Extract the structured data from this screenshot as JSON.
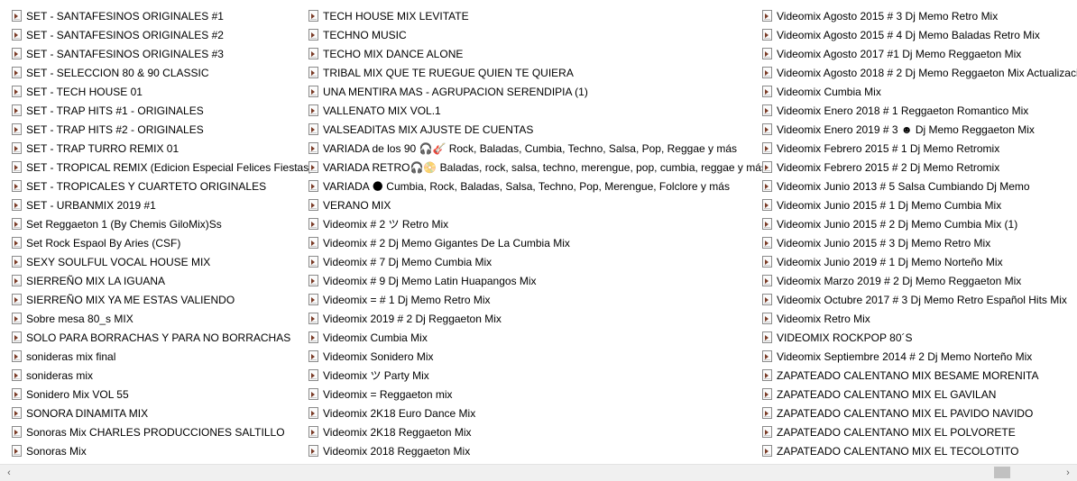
{
  "files": {
    "col1": [
      "SET - SANTAFESINOS ORIGINALES #1",
      "SET - SANTAFESINOS ORIGINALES #2",
      "SET - SANTAFESINOS ORIGINALES #3",
      "SET - SELECCION 80 & 90 CLASSIC",
      "SET - TECH HOUSE 01",
      "SET - TRAP HITS #1 - ORIGINALES",
      "SET - TRAP HITS #2 - ORIGINALES",
      "SET - TRAP TURRO REMIX 01",
      "SET - TROPICAL REMIX (Edicion Especial Felices Fiestas)",
      "SET - TROPICALES Y CUARTETO ORIGINALES",
      "SET - URBANMIX 2019  #1",
      "Set Reggaeton 1 (By Chemis GiloMix)Ss",
      "Set Rock Espaol By Aries (CSF)",
      "SEXY SOULFUL VOCAL HOUSE MIX",
      "SIERREÑO MIX LA IGUANA",
      "SIERREÑO MIX YA ME ESTAS VALIENDO",
      "Sobre mesa 80_s  MIX",
      "SOLO PARA BORRACHAS Y PARA NO BORRACHAS",
      "sonideras mix final",
      "sonideras mix",
      "Sonidero Mix VOL 55",
      "SONORA DINAMITA MIX",
      "Sonoras Mix CHARLES PRODUCCIONES SALTILLO",
      "Sonoras Mix"
    ],
    "col2": [
      "TECH HOUSE MIX LEVITATE",
      "TECHNO MUSIC",
      "TECHO MIX DANCE ALONE",
      "TRIBAL MIX QUE TE RUEGUE QUIEN TE QUIERA",
      "UNA MENTIRA MAS - AGRUPACION SERENDIPIA (1)",
      "VALLENATO MIX VOL.1",
      "VALSEADITAS MIX AJUSTE DE CUENTAS",
      "VARIADA de los 90 🎧🎸 Rock, Baladas, Cumbia, Techno, Salsa, Pop, Reggae y más",
      "VARIADA RETRO🎧📀 Baladas, rock, salsa, techno, merengue, pop, cumbia, reggae y más",
      "VARIADA 🌑 Cumbia, Rock, Baladas, Salsa, Techno, Pop, Merengue, Folclore y más",
      "VERANO MIX",
      "Videomix  # 2  ツ Retro Mix",
      "Videomix  # 2 Dj Memo Gigantes De La Cumbia Mix",
      "Videomix  # 7 Dj Memo Cumbia Mix",
      "Videomix  # 9 Dj Memo Latin Huapangos Mix",
      "Videomix  = # 1 Dj Memo Retro Mix",
      "Videomix  2019 # 2 Dj  Reggaeton Mix",
      "Videomix  Cumbia Mix",
      "Videomix  Sonidero Mix",
      "Videomix  ツ  Party Mix",
      "Videomix = Reggaeton mix",
      "Videomix 2K18 Euro Dance Mix",
      "Videomix 2K18 Reggaeton Mix",
      "Videomix 2018 Reggaeton Mix"
    ],
    "col3": [
      "Videomix Agosto 2015 # 3 Dj Memo Retro Mix",
      "Videomix Agosto 2015 # 4 Dj Memo Baladas Retro Mix",
      "Videomix Agosto 2017 #1 Dj Memo Reggaeton Mix",
      "Videomix Agosto 2018 # 2 Dj Memo Reggaeton Mix Actualizaci",
      "Videomix Cumbia Mix",
      "Videomix Enero 2018 # 1 Reggaeton Romantico Mix",
      "Videomix Enero 2019 # 3 ☻ Dj Memo Reggaeton Mix",
      "Videomix Febrero 2015 # 1 Dj Memo Retromix",
      "Videomix Febrero 2015 # 2 Dj Memo Retromix",
      "Videomix Junio 2013 # 5 Salsa Cumbiando Dj Memo",
      "Videomix Junio 2015 # 1 Dj Memo Cumbia Mix",
      "Videomix Junio 2015 # 2 Dj Memo Cumbia Mix (1)",
      "Videomix Junio 2015 # 3 Dj Memo Retro Mix",
      "Videomix Junio 2019 # 1 Dj Memo Norteño Mix",
      "Videomix Marzo 2019 # 2 Dj Memo Reggaeton Mix",
      "Videomix Octubre 2017 # 3 Dj Memo Retro Español Hits Mix",
      "Videomix Retro Mix",
      "VIDEOMIX ROCKPOP 80´S",
      "Videomix Septiembre 2014 # 2 Dj Memo Norteño Mix",
      "ZAPATEADO CALENTANO MIX BESAME MORENITA",
      "ZAPATEADO CALENTANO MIX EL GAVILAN",
      "ZAPATEADO CALENTANO MIX EL PAVIDO NAVIDO",
      "ZAPATEADO CALENTANO MIX EL POLVORETE",
      "ZAPATEADO CALENTANO MIX EL TECOLOTITO"
    ]
  },
  "icons": {
    "file": "video-file-icon",
    "scroll_left": "‹",
    "scroll_right": "›"
  },
  "colors": {
    "scroll_track": "#f0f0f0",
    "scroll_thumb": "#c1c1c1"
  }
}
